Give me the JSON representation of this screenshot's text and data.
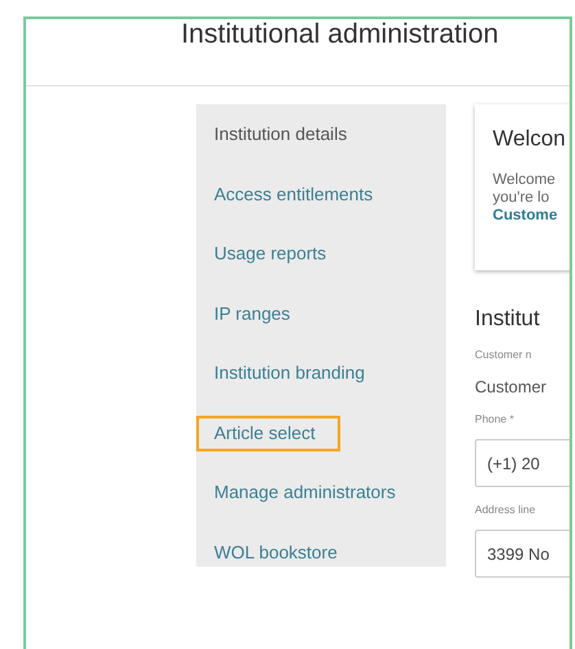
{
  "header": {
    "title": "Institutional administration"
  },
  "sidebar": {
    "items": [
      {
        "label": "Institution details",
        "selected": true,
        "highlighted": false
      },
      {
        "label": "Access entitlements",
        "selected": false,
        "highlighted": false
      },
      {
        "label": "Usage reports",
        "selected": false,
        "highlighted": false
      },
      {
        "label": "IP ranges",
        "selected": false,
        "highlighted": false
      },
      {
        "label": "Institution branding",
        "selected": false,
        "highlighted": false
      },
      {
        "label": "Article select",
        "selected": false,
        "highlighted": true
      },
      {
        "label": "Manage administrators",
        "selected": false,
        "highlighted": false
      },
      {
        "label": "WOL bookstore",
        "selected": false,
        "highlighted": false
      }
    ]
  },
  "welcome_card": {
    "title": "Welcon",
    "lines": [
      "Welcome",
      "you're lo"
    ],
    "link": "Custome"
  },
  "form": {
    "title": "Institut",
    "fields": [
      {
        "kind": "static",
        "label": "Customer n",
        "value": "Customer"
      },
      {
        "kind": "input",
        "label": "Phone *",
        "value": "(+1) 20"
      },
      {
        "kind": "input",
        "label": "Address line",
        "value": "3399 No"
      }
    ]
  }
}
